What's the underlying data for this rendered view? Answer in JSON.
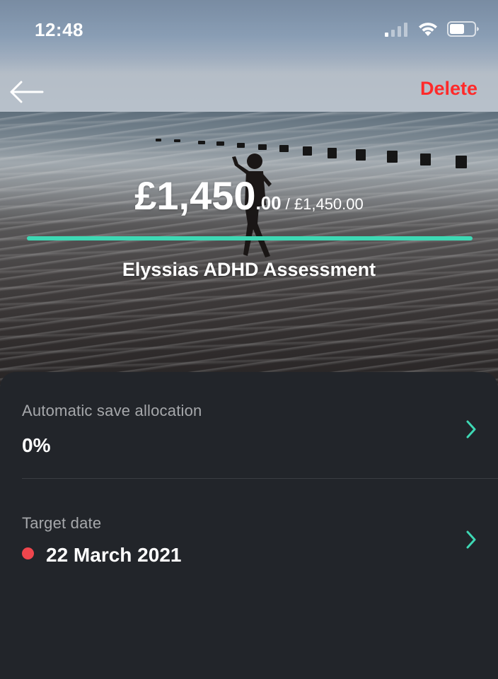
{
  "status_bar": {
    "time": "12:48",
    "icons": [
      "cellular-signal-icon",
      "wifi-icon",
      "battery-icon"
    ]
  },
  "nav": {
    "back_icon": "arrow-left-icon",
    "delete_label": "Delete"
  },
  "goal": {
    "amount_main": "£1,450",
    "amount_pence": ".00",
    "amount_target": "/ £1,450.00",
    "progress_fraction": 1.0,
    "title": "Elyssias ADHD Assessment"
  },
  "settings": {
    "allocation": {
      "label": "Automatic save allocation",
      "value": "0%"
    },
    "target_date": {
      "label": "Target date",
      "value": "22 March 2021",
      "status_color": "#f0464d"
    }
  },
  "colors": {
    "accent": "#3ed8b4",
    "delete": "#ff2a2a",
    "sheet_background": "#22252a"
  }
}
